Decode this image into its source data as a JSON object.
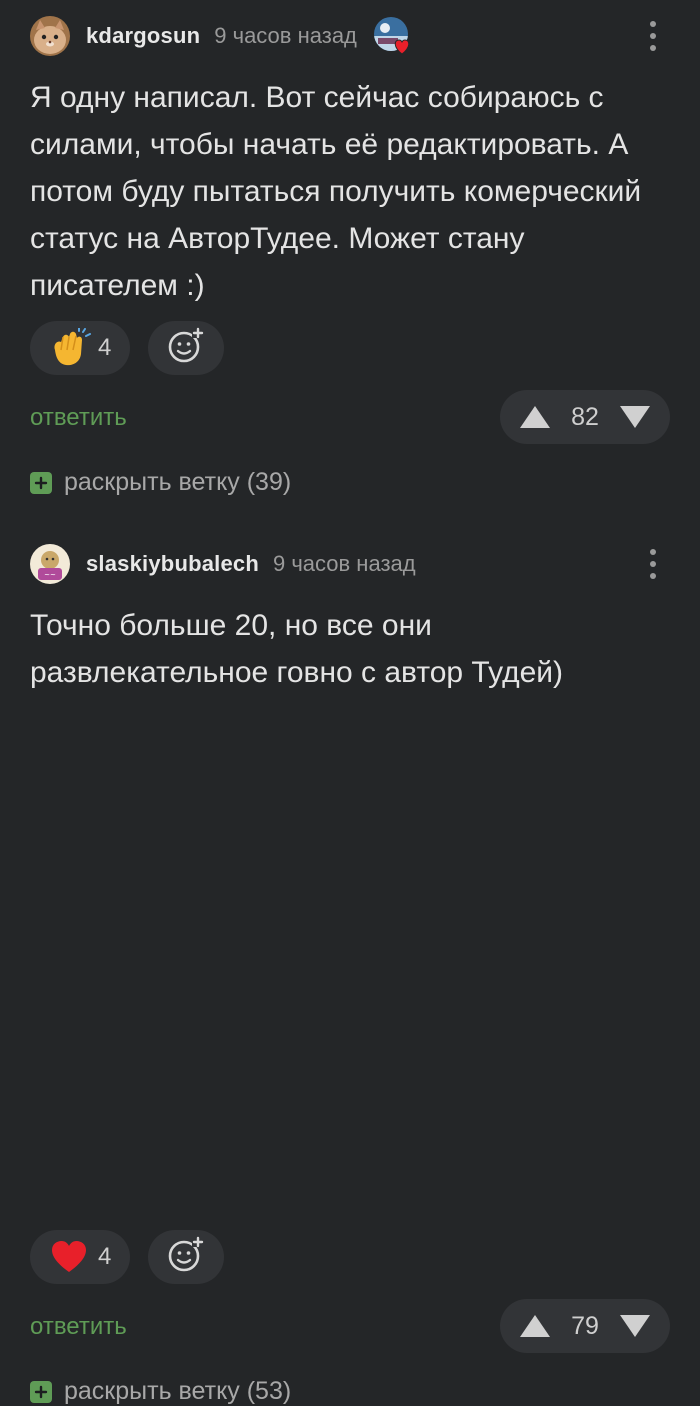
{
  "comments": [
    {
      "username": "kdargosun",
      "time": "9 часов назад",
      "text": "Я одну написал. Вот сейчас собираюсь с силами, чтобы начать её редактировать. А потом буду пытаться получить комерческий статус на АвторТудее. Может стану писателем :)",
      "reaction": {
        "icon": "clap-icon",
        "count": "4"
      },
      "reply_label": "ответить",
      "score": "82",
      "expand_label": "раскрыть ветку (39)"
    },
    {
      "username": "slaskiybubalech",
      "time": "9 часов назад",
      "text": "Точно больше 20, но все они развлекательное говно с автор Тудей)",
      "reaction": {
        "icon": "heart-icon",
        "count": "4"
      },
      "reply_label": "ответить",
      "score": "79",
      "expand_label": "раскрыть ветку (53)"
    }
  ],
  "colors": {
    "background": "#242628",
    "pill": "#323437",
    "accent_green": "#5f9c56",
    "heart_red": "#e8202a",
    "clap_yellow": "#f5b631"
  }
}
